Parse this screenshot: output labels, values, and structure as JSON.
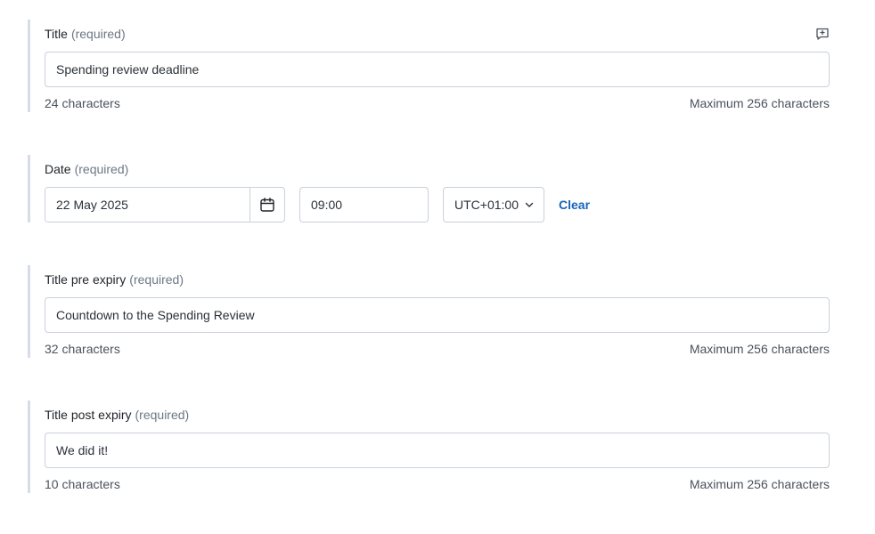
{
  "fields": {
    "title": {
      "label": "Title",
      "required": "(required)",
      "value": "Spending review deadline",
      "count": "24 characters",
      "max": "Maximum 256 characters"
    },
    "date": {
      "label": "Date",
      "required": "(required)",
      "date_value": "22 May 2025",
      "time_value": "09:00",
      "timezone": "UTC+01:00",
      "clear_label": "Clear"
    },
    "title_pre": {
      "label": "Title pre expiry",
      "required": "(required)",
      "value": "Countdown to the Spending Review",
      "count": "32 characters",
      "max": "Maximum 256 characters"
    },
    "title_post": {
      "label": "Title post expiry",
      "required": "(required)",
      "value": "We did it!",
      "count": "10 characters",
      "max": "Maximum 256 characters"
    }
  },
  "icons": {
    "comment": "comment-add-icon",
    "calendar": "calendar-icon",
    "dropdown": "chevron-down-icon"
  }
}
